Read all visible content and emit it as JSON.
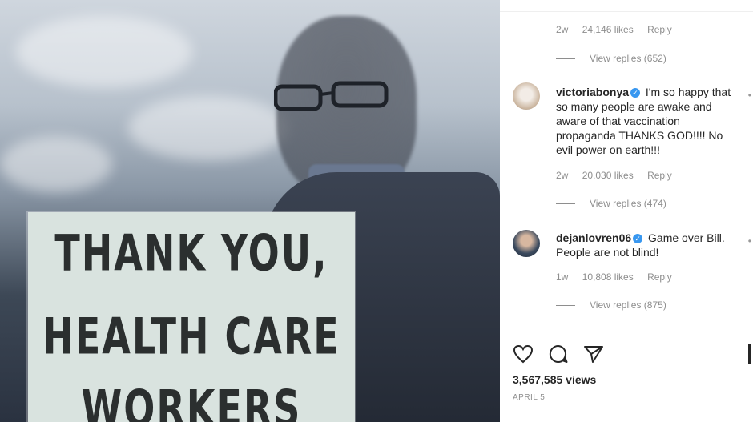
{
  "post": {
    "sign_lines": [
      "THANK YOU,",
      "HEALTH CARE",
      "WORKERS"
    ]
  },
  "comments": [
    {
      "username": "",
      "text": "",
      "age": "2w",
      "likes": "24,146 likes",
      "reply": "Reply",
      "view_replies": "View replies (652)"
    },
    {
      "username": "victoriabonya",
      "text": "I'm so happy that so many people are awake and aware of that vaccination propaganda THANKS GOD!!!! No evil power on earth!!!",
      "age": "2w",
      "likes": "20,030 likes",
      "reply": "Reply",
      "view_replies": "View replies (474)"
    },
    {
      "username": "dejanlovren06",
      "text": "Game over Bill. People are not blind!",
      "age": "1w",
      "likes": "10,808 likes",
      "reply": "Reply",
      "view_replies": "View replies (875)"
    }
  ],
  "actions": {
    "like_icon": "heart-icon",
    "comment_icon": "comment-icon",
    "share_icon": "share-icon",
    "save_icon": "bookmark-icon"
  },
  "views": "3,567,585 views",
  "date": "APRIL 5",
  "colors": {
    "verified": "#3897f0",
    "muted_text": "#8e8e8e",
    "text": "#262626"
  }
}
